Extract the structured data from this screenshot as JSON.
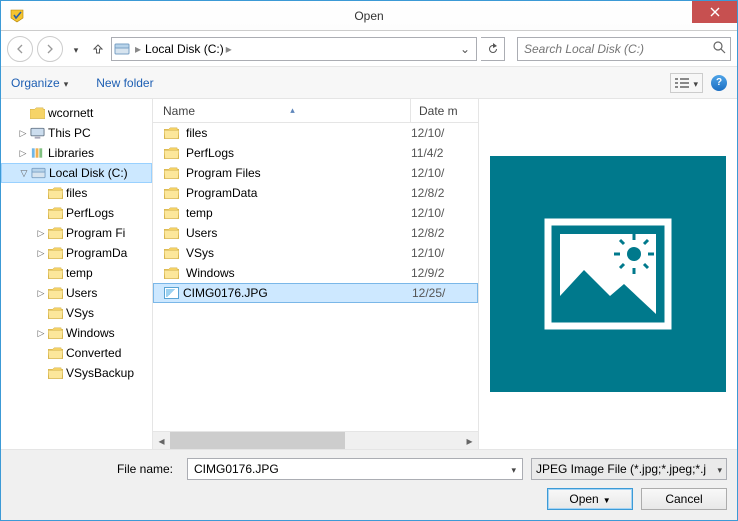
{
  "title": "Open",
  "breadcrumb": {
    "location": "Local Disk (C:)"
  },
  "search": {
    "placeholder": "Search Local Disk (C:)"
  },
  "toolbar": {
    "organize": "Organize",
    "newfolder": "New folder"
  },
  "columns": {
    "name": "Name",
    "date": "Date m"
  },
  "tree": [
    {
      "label": "wcornett",
      "indent": 1,
      "icon": "user",
      "twist": ""
    },
    {
      "label": "This PC",
      "indent": 1,
      "icon": "pc",
      "twist": "▷"
    },
    {
      "label": "Libraries",
      "indent": 1,
      "icon": "lib",
      "twist": "▷"
    },
    {
      "label": "Local Disk (C:)",
      "indent": 1,
      "icon": "disk",
      "twist": "▽",
      "sel": true
    },
    {
      "label": "files",
      "indent": 2,
      "icon": "folder",
      "twist": ""
    },
    {
      "label": "PerfLogs",
      "indent": 2,
      "icon": "folder",
      "twist": ""
    },
    {
      "label": "Program Fi",
      "indent": 2,
      "icon": "folder",
      "twist": "▷"
    },
    {
      "label": "ProgramDa",
      "indent": 2,
      "icon": "folder",
      "twist": "▷"
    },
    {
      "label": "temp",
      "indent": 2,
      "icon": "folder",
      "twist": ""
    },
    {
      "label": "Users",
      "indent": 2,
      "icon": "folder",
      "twist": "▷"
    },
    {
      "label": "VSys",
      "indent": 2,
      "icon": "folder",
      "twist": ""
    },
    {
      "label": "Windows",
      "indent": 2,
      "icon": "folder",
      "twist": "▷"
    },
    {
      "label": "Converted",
      "indent": 2,
      "icon": "folder",
      "twist": ""
    },
    {
      "label": "VSysBackup",
      "indent": 2,
      "icon": "folder",
      "twist": ""
    }
  ],
  "files": [
    {
      "name": "files",
      "date": "12/10/",
      "type": "folder"
    },
    {
      "name": "PerfLogs",
      "date": "11/4/2",
      "type": "folder"
    },
    {
      "name": "Program Files",
      "date": "12/10/",
      "type": "folder"
    },
    {
      "name": "ProgramData",
      "date": "12/8/2",
      "type": "folder"
    },
    {
      "name": "temp",
      "date": "12/10/",
      "type": "folder"
    },
    {
      "name": "Users",
      "date": "12/8/2",
      "type": "folder"
    },
    {
      "name": "VSys",
      "date": "12/10/",
      "type": "folder"
    },
    {
      "name": "Windows",
      "date": "12/9/2",
      "type": "folder"
    },
    {
      "name": "CIMG0176.JPG",
      "date": "12/25/",
      "type": "image",
      "sel": true
    }
  ],
  "filename": {
    "label": "File name:",
    "value": "CIMG0176.JPG"
  },
  "filetype": {
    "label": "JPEG Image File (*.jpg;*.jpeg;*.j"
  },
  "buttons": {
    "open": "Open",
    "cancel": "Cancel"
  }
}
